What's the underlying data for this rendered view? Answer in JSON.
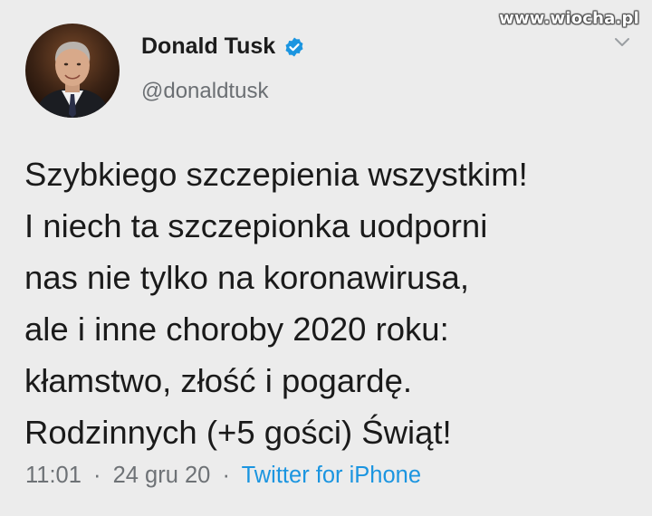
{
  "watermark": "www.wiocha.pl",
  "header": {
    "display_name": "Donald Tusk",
    "handle": "@donaldtusk",
    "verified": true
  },
  "tweet": {
    "lines": [
      "Szybkiego szczepienia wszystkim!",
      "I niech ta szczepionka uodporni",
      "nas nie tylko na koronawirusa,",
      "ale i inne choroby 2020 roku:",
      "kłamstwo, złość i pogardę.",
      "Rodzinnych (+5 gości) Świąt!"
    ]
  },
  "meta": {
    "time": "11:01",
    "separator": "·",
    "date": "24 gru 20",
    "source": "Twitter for iPhone"
  },
  "colors": {
    "background": "#ececec",
    "text": "#1a1a1a",
    "secondary_text": "#6e7276",
    "link": "#1b95e0",
    "verified_badge": "#1b95e0"
  },
  "icons": {
    "verified": "verified-badge-icon",
    "chevron": "chevron-down-icon"
  }
}
